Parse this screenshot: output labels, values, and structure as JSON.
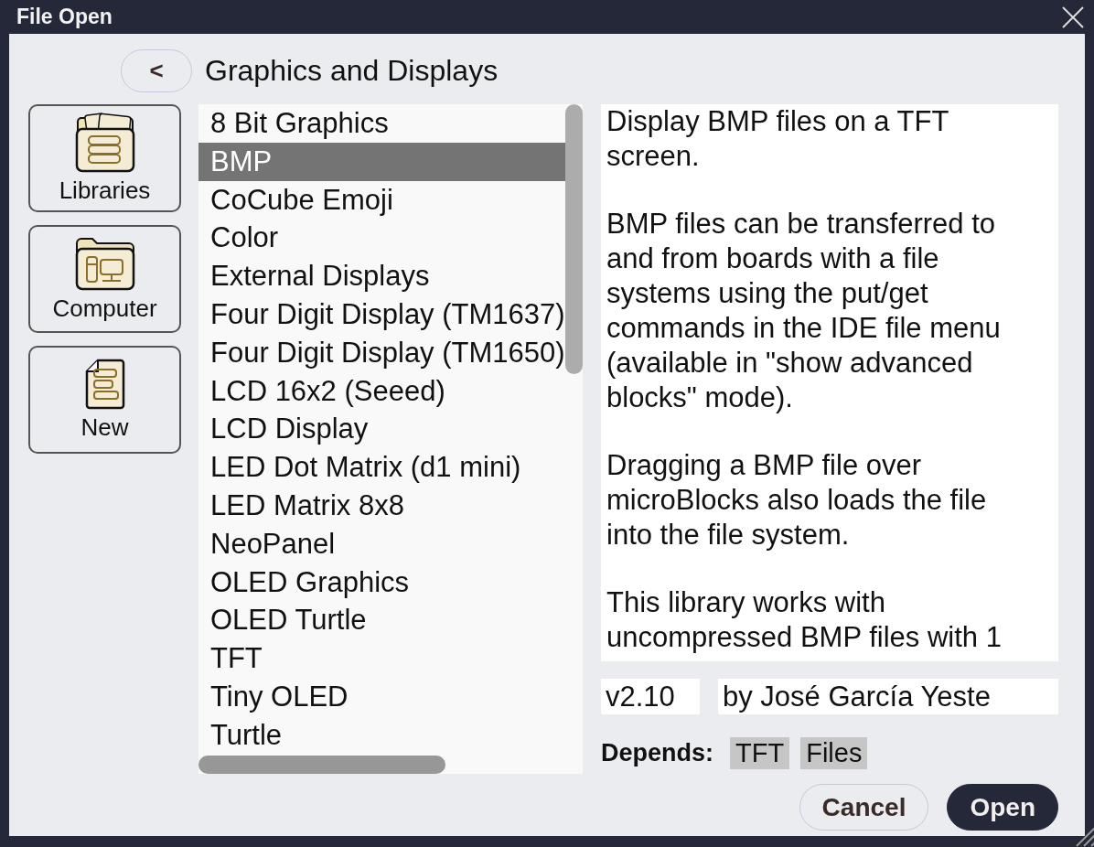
{
  "window": {
    "title": "File Open"
  },
  "back_button": {
    "label": "<"
  },
  "folder_title": "Graphics and Displays",
  "sidebar": [
    {
      "kind": "libraries",
      "label": "Libraries"
    },
    {
      "kind": "computer",
      "label": "Computer"
    },
    {
      "kind": "new",
      "label": "New"
    }
  ],
  "files": [
    {
      "name": "8 Bit Graphics",
      "selected": false
    },
    {
      "name": "BMP",
      "selected": true
    },
    {
      "name": "CoCube Emoji",
      "selected": false
    },
    {
      "name": "Color",
      "selected": false
    },
    {
      "name": "External Displays",
      "selected": false
    },
    {
      "name": "Four Digit Display (TM1637)",
      "selected": false
    },
    {
      "name": "Four Digit Display (TM1650)",
      "selected": false
    },
    {
      "name": "LCD 16x2 (Seeed)",
      "selected": false
    },
    {
      "name": "LCD Display",
      "selected": false
    },
    {
      "name": "LED Dot Matrix (d1 mini)",
      "selected": false
    },
    {
      "name": "LED Matrix 8x8",
      "selected": false
    },
    {
      "name": "NeoPanel",
      "selected": false
    },
    {
      "name": "OLED Graphics",
      "selected": false
    },
    {
      "name": "OLED Turtle",
      "selected": false
    },
    {
      "name": "TFT",
      "selected": false
    },
    {
      "name": "Tiny OLED",
      "selected": false
    },
    {
      "name": "Turtle",
      "selected": false
    }
  ],
  "description": [
    "Display BMP files on a TFT screen.",
    "BMP files can be transferred to and from boards with a file systems using the put/get commands in the IDE file menu (available in \"show advanced blocks\" mode).",
    "Dragging a BMP file over microBlocks also loads the file into the file system.",
    "This library works with uncompressed BMP files with 1"
  ],
  "version": "v2.10",
  "author": "by José García Yeste",
  "depends": {
    "label": "Depends:",
    "items": [
      "TFT",
      "Files"
    ]
  },
  "buttons": [
    {
      "kind": "secondary",
      "label": "Cancel"
    },
    {
      "kind": "primary",
      "label": "Open"
    }
  ]
}
